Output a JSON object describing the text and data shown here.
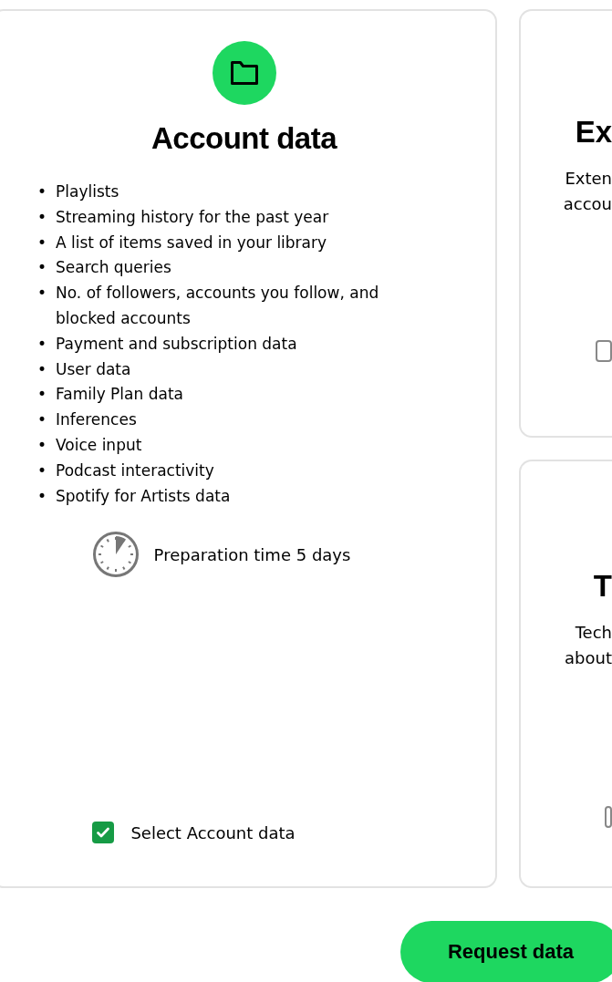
{
  "cards": [
    {
      "kind": "full",
      "title": "Account data",
      "bullet": "•",
      "items": [
        "Playlists",
        "Streaming history for the past year",
        "A list of items saved in your library",
        "Search queries",
        "No. of followers, accounts you follow, and blocked accounts",
        "Payment and subscription data",
        "User data",
        "Family Plan data",
        "Inferences",
        "Voice input",
        "Podcast interactivity",
        "Spotify for Artists data"
      ],
      "preparation": "Preparation time 5 days",
      "checkbox": {
        "label": "Select Account data",
        "checked": true
      }
    },
    {
      "kind": "clipped",
      "title": "Ex",
      "lines": [
        "Exten",
        "accou"
      ],
      "checkbox": {
        "checked": false
      }
    },
    {
      "kind": "clipped",
      "title": "T",
      "lines": [
        "Tech",
        "about"
      ],
      "checkbox": {
        "checked": false
      }
    }
  ],
  "button": "Request data"
}
